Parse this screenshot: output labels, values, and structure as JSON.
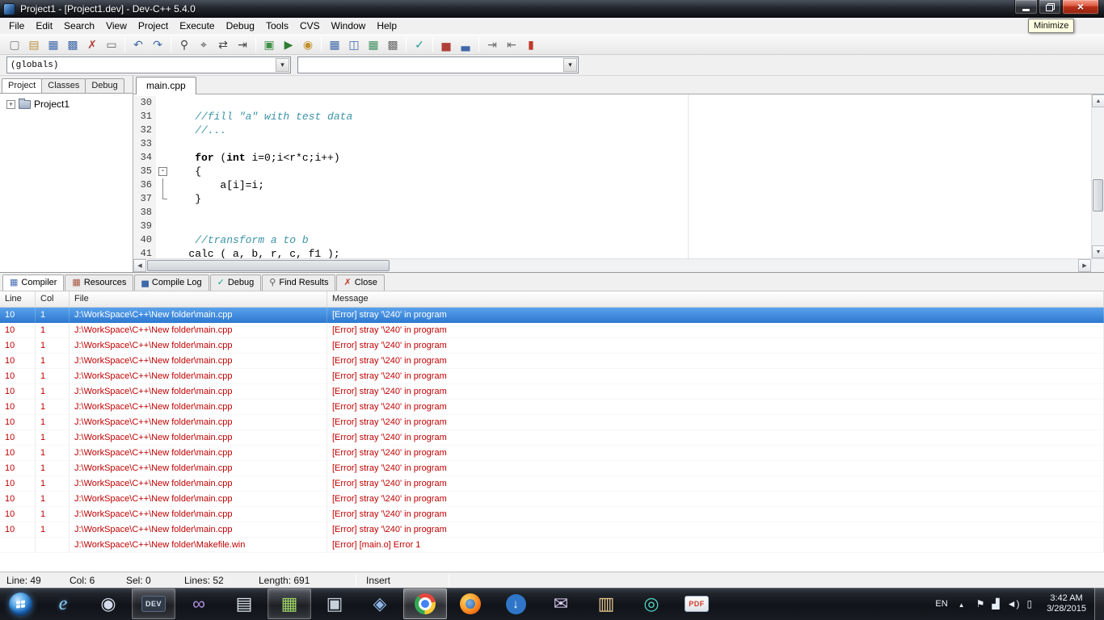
{
  "window": {
    "title": "Project1 - [Project1.dev] - Dev-C++ 5.4.0",
    "tooltip": "Minimize"
  },
  "menu": {
    "items": [
      "File",
      "Edit",
      "Search",
      "View",
      "Project",
      "Execute",
      "Debug",
      "Tools",
      "CVS",
      "Window",
      "Help"
    ]
  },
  "toolbar": {
    "buttons": [
      {
        "name": "new-source",
        "glyph": "▢",
        "color": "#7a7a7a"
      },
      {
        "name": "open",
        "glyph": "▤",
        "color": "#b98f3e"
      },
      {
        "name": "save",
        "glyph": "▦",
        "color": "#3f68a8"
      },
      {
        "name": "save-all",
        "glyph": "▩",
        "color": "#3f68a8"
      },
      {
        "name": "close-file",
        "glyph": "✗",
        "color": "#b04038"
      },
      {
        "name": "print",
        "glyph": "▭",
        "color": "#6a6a6a"
      },
      {
        "sep": true
      },
      {
        "name": "undo",
        "glyph": "↶",
        "color": "#3f68a8"
      },
      {
        "name": "redo",
        "glyph": "↷",
        "color": "#3f68a8"
      },
      {
        "sep": true
      },
      {
        "name": "find",
        "glyph": "⚲",
        "color": "#444444"
      },
      {
        "name": "find-in-files",
        "glyph": "⌖",
        "color": "#444444"
      },
      {
        "name": "replace",
        "glyph": "⇄",
        "color": "#444444"
      },
      {
        "name": "goto-line",
        "glyph": "⇥",
        "color": "#444444"
      },
      {
        "sep": true
      },
      {
        "name": "compile",
        "glyph": "▣",
        "color": "#3f8f46"
      },
      {
        "name": "run",
        "glyph": "▶",
        "color": "#2e7d32"
      },
      {
        "name": "compile-and-run",
        "glyph": "◉",
        "color": "#c2912e"
      },
      {
        "sep": true
      },
      {
        "name": "project-view",
        "glyph": "▦",
        "color": "#3f68a8"
      },
      {
        "name": "split-view",
        "glyph": "◫",
        "color": "#3f68a8"
      },
      {
        "name": "report-view",
        "glyph": "▦",
        "color": "#3f8f5f"
      },
      {
        "name": "grid-view",
        "glyph": "▩",
        "color": "#6a6a6a"
      },
      {
        "sep": true
      },
      {
        "name": "syntax-check",
        "glyph": "✓",
        "color": "#1f9e8e"
      },
      {
        "sep": true
      },
      {
        "name": "profile",
        "glyph": "▅",
        "color": "#b04038"
      },
      {
        "name": "profiling-log",
        "glyph": "▃",
        "color": "#3f68a8"
      },
      {
        "sep": true
      },
      {
        "name": "insert",
        "glyph": "⇥",
        "color": "#6a6a6a"
      },
      {
        "name": "goto-bookmark",
        "glyph": "⇤",
        "color": "#6a6a6a"
      },
      {
        "name": "abort-compilation",
        "glyph": "▮",
        "color": "#c0392b"
      }
    ]
  },
  "combos": {
    "globals": "(globals)",
    "members": ""
  },
  "left_tabs": [
    {
      "label": "Project",
      "selected": true
    },
    {
      "label": "Classes",
      "selected": false
    },
    {
      "label": "Debug",
      "selected": false
    }
  ],
  "tree": {
    "root": "Project1"
  },
  "editor": {
    "tab": "main.cpp",
    "lines": [
      {
        "num": "30",
        "segs": []
      },
      {
        "num": "31",
        "segs": [
          {
            "t": "    "
          },
          {
            "t": "//fill \"a\" with test data",
            "c": "cm"
          }
        ]
      },
      {
        "num": "32",
        "segs": [
          {
            "t": "    "
          },
          {
            "t": "//...",
            "c": "cm"
          }
        ]
      },
      {
        "num": "33",
        "segs": []
      },
      {
        "num": "34",
        "segs": [
          {
            "t": "    "
          },
          {
            "t": "for",
            "c": "kw"
          },
          {
            "t": " ("
          },
          {
            "t": "int",
            "c": "kw"
          },
          {
            "t": " i=0;i<r*c;i++)"
          }
        ]
      },
      {
        "num": "35",
        "fold": "open",
        "segs": [
          {
            "t": "    {"
          }
        ]
      },
      {
        "num": "36",
        "fold": "line",
        "segs": [
          {
            "t": "        a[i]=i;"
          }
        ]
      },
      {
        "num": "37",
        "fold": "end",
        "segs": [
          {
            "t": "    }"
          }
        ]
      },
      {
        "num": "38",
        "segs": []
      },
      {
        "num": "39",
        "segs": []
      },
      {
        "num": "40",
        "segs": [
          {
            "t": "    "
          },
          {
            "t": "//transform a to b",
            "c": "cm"
          }
        ]
      },
      {
        "num": "41",
        "segs": [
          {
            "t": "   "
          },
          {
            "t": "calc ( a, b, r, c, f1 );"
          }
        ]
      }
    ]
  },
  "bottom_tabs": [
    {
      "label": "Compiler",
      "glyph": "▦",
      "color": "#4a6fb5",
      "selected": true
    },
    {
      "label": "Resources",
      "glyph": "▦",
      "color": "#a8543f",
      "selected": false
    },
    {
      "label": "Compile Log",
      "glyph": "▅",
      "color": "#3f68a8",
      "selected": false
    },
    {
      "label": "Debug",
      "glyph": "✓",
      "color": "#1f9e8e",
      "selected": false
    },
    {
      "label": "Find Results",
      "glyph": "⚲",
      "color": "#555555",
      "selected": false
    },
    {
      "label": "Close",
      "glyph": "✗",
      "color": "#c0392b",
      "selected": false
    }
  ],
  "compiler": {
    "columns": [
      "Line",
      "Col",
      "File",
      "Message"
    ],
    "rows": [
      {
        "line": "10",
        "col": "1",
        "file": "J:\\WorkSpace\\C++\\New folder\\main.cpp",
        "message": "[Error] stray '\\240' in program",
        "selected": true
      },
      {
        "line": "10",
        "col": "1",
        "file": "J:\\WorkSpace\\C++\\New folder\\main.cpp",
        "message": "[Error] stray '\\240' in program",
        "selected": false
      },
      {
        "line": "10",
        "col": "1",
        "file": "J:\\WorkSpace\\C++\\New folder\\main.cpp",
        "message": "[Error] stray '\\240' in program",
        "selected": false
      },
      {
        "line": "10",
        "col": "1",
        "file": "J:\\WorkSpace\\C++\\New folder\\main.cpp",
        "message": "[Error] stray '\\240' in program",
        "selected": false
      },
      {
        "line": "10",
        "col": "1",
        "file": "J:\\WorkSpace\\C++\\New folder\\main.cpp",
        "message": "[Error] stray '\\240' in program",
        "selected": false
      },
      {
        "line": "10",
        "col": "1",
        "file": "J:\\WorkSpace\\C++\\New folder\\main.cpp",
        "message": "[Error] stray '\\240' in program",
        "selected": false
      },
      {
        "line": "10",
        "col": "1",
        "file": "J:\\WorkSpace\\C++\\New folder\\main.cpp",
        "message": "[Error] stray '\\240' in program",
        "selected": false
      },
      {
        "line": "10",
        "col": "1",
        "file": "J:\\WorkSpace\\C++\\New folder\\main.cpp",
        "message": "[Error] stray '\\240' in program",
        "selected": false
      },
      {
        "line": "10",
        "col": "1",
        "file": "J:\\WorkSpace\\C++\\New folder\\main.cpp",
        "message": "[Error] stray '\\240' in program",
        "selected": false
      },
      {
        "line": "10",
        "col": "1",
        "file": "J:\\WorkSpace\\C++\\New folder\\main.cpp",
        "message": "[Error] stray '\\240' in program",
        "selected": false
      },
      {
        "line": "10",
        "col": "1",
        "file": "J:\\WorkSpace\\C++\\New folder\\main.cpp",
        "message": "[Error] stray '\\240' in program",
        "selected": false
      },
      {
        "line": "10",
        "col": "1",
        "file": "J:\\WorkSpace\\C++\\New folder\\main.cpp",
        "message": "[Error] stray '\\240' in program",
        "selected": false
      },
      {
        "line": "10",
        "col": "1",
        "file": "J:\\WorkSpace\\C++\\New folder\\main.cpp",
        "message": "[Error] stray '\\240' in program",
        "selected": false
      },
      {
        "line": "10",
        "col": "1",
        "file": "J:\\WorkSpace\\C++\\New folder\\main.cpp",
        "message": "[Error] stray '\\240' in program",
        "selected": false
      },
      {
        "line": "10",
        "col": "1",
        "file": "J:\\WorkSpace\\C++\\New folder\\main.cpp",
        "message": "[Error] stray '\\240' in program",
        "selected": false
      },
      {
        "line": "",
        "col": "",
        "file": "J:\\WorkSpace\\C++\\New folder\\Makefile.win",
        "message": "[Error] [main.o] Error 1",
        "selected": false
      }
    ]
  },
  "statusbar": {
    "metrics": [
      "Line: 49",
      "Col: 6",
      "Sel: 0",
      "Lines: 52",
      "Length: 691"
    ],
    "mode": "Insert"
  },
  "taskbar": {
    "language": "EN",
    "time": "3:42 AM",
    "date": "3/28/2015",
    "icons": [
      {
        "name": "internet-explorer",
        "kind": "ie",
        "glyph": "e"
      },
      {
        "name": "media-player",
        "glyph": "◉",
        "color": "#d3dce8"
      },
      {
        "name": "dev-cpp",
        "kind": "text",
        "text": "DEV",
        "active": true
      },
      {
        "name": "visual-studio",
        "glyph": "∞",
        "color": "#b08fe0"
      },
      {
        "name": "text-editor",
        "glyph": "▤",
        "color": "#dde4ec"
      },
      {
        "name": "snipping-tool",
        "glyph": "▦",
        "color": "#9fd468",
        "active": true
      },
      {
        "name": "office-app",
        "glyph": "▣",
        "color": "#c8d1db"
      },
      {
        "name": "maps-app",
        "glyph": "◈",
        "color": "#8fb8e8"
      },
      {
        "name": "chrome",
        "kind": "chrome",
        "active": true,
        "bright": true
      },
      {
        "name": "firefox",
        "kind": "firefox"
      },
      {
        "name": "download-manager",
        "glyph": "↓",
        "color": "#ffffff",
        "circle": "#2f76c8"
      },
      {
        "name": "messenger",
        "glyph": "✉",
        "color": "#d8c9ee"
      },
      {
        "name": "documents-app",
        "glyph": "▥",
        "color": "#e8c98f"
      },
      {
        "name": "torrent-app",
        "glyph": "◎",
        "color": "#4fd8c4"
      },
      {
        "name": "pdf-reader",
        "kind": "text",
        "text": "PDF",
        "pdfStyle": true
      }
    ],
    "tray_icons": [
      {
        "name": "action-center-icon",
        "glyph": "⚑"
      },
      {
        "name": "network-icon",
        "glyph": "▟"
      },
      {
        "name": "volume-icon",
        "glyph": "◄)"
      },
      {
        "name": "power-icon",
        "glyph": "▯"
      }
    ]
  }
}
